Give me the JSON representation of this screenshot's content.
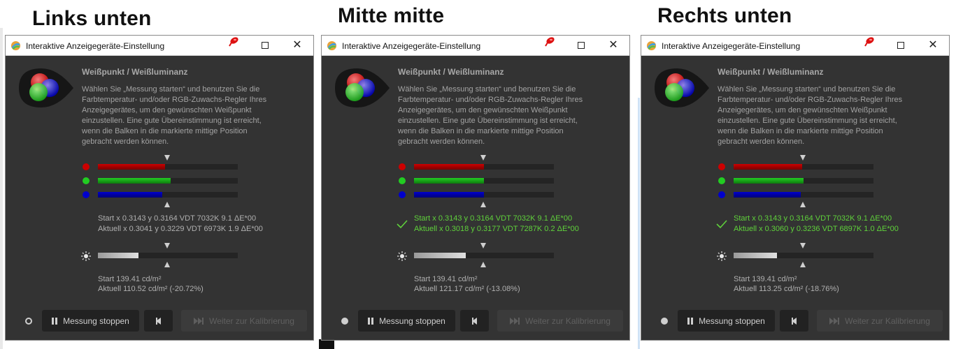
{
  "headings": [
    "Links unten",
    "Mitte mitte",
    "Rechts unten"
  ],
  "colors": {
    "red": "#cc0000",
    "green": "#22cc22",
    "blue": "#0000cc",
    "white_fill": "#e0e0e0",
    "ok_green": "#5fd13b",
    "window_bg": "#333333",
    "bar_track": "#242424"
  },
  "windows": [
    {
      "title": "Interaktive Anzeigegeräte-Einstellung",
      "section_title": "Weißpunkt / Weißluminanz",
      "description": "Wählen Sie „Messung starten“ und benutzen Sie die\nFarbtemperatur- und/oder RGB-Zuwachs-Regler Ihres\nAnzeigegerätes, um den gewünschten Weißpunkt\neinzustellen. Eine gute Übereinstimmung ist erreicht,\nwenn die Balken in die markierte mittige Position\ngebracht werden können.",
      "bars": {
        "red": 0.48,
        "green": 0.52,
        "blue": 0.46,
        "luminance": 0.29
      },
      "whitepoint_ok": false,
      "whitepoint_start": "Start x 0.3143 y 0.3164 VDT 7032K 9.1 ΔE*00",
      "whitepoint_current": "Aktuell x 0.3041 y 0.3229 VDT 6973K 1.9 ΔE*00",
      "luminance_start": "Start 139.41 cd/m²",
      "luminance_current": "Aktuell 110.52 cd/m² (-20.72%)",
      "status_indicator": "ring",
      "stop_button": "Messung stoppen",
      "next_button": "Weiter zur Kalibrierung"
    },
    {
      "title": "Interaktive Anzeigegeräte-Einstellung",
      "section_title": "Weißpunkt / Weißluminanz",
      "description": "Wählen Sie „Messung starten“ und benutzen Sie die\nFarbtemperatur- und/oder RGB-Zuwachs-Regler Ihres\nAnzeigegerätes, um den gewünschten Weißpunkt\neinzustellen. Eine gute Übereinstimmung ist erreicht,\nwenn die Balken in die markierte mittige Position\ngebracht werden können.",
      "bars": {
        "red": 0.5,
        "green": 0.5,
        "blue": 0.5,
        "luminance": 0.37
      },
      "whitepoint_ok": true,
      "whitepoint_start": "Start x 0.3143 y 0.3164 VDT 7032K 9.1 ΔE*00",
      "whitepoint_current": "Aktuell x 0.3018 y 0.3177 VDT 7287K 0.2 ΔE*00",
      "luminance_start": "Start 139.41 cd/m²",
      "luminance_current": "Aktuell 121.17 cd/m² (-13.08%)",
      "status_indicator": "dot",
      "stop_button": "Messung stoppen",
      "next_button": "Weiter zur Kalibrierung"
    },
    {
      "title": "Interaktive Anzeigegeräte-Einstellung",
      "section_title": "Weißpunkt / Weißluminanz",
      "description": "Wählen Sie „Messung starten“ und benutzen Sie die\nFarbtemperatur- und/oder RGB-Zuwachs-Regler Ihres\nAnzeigegerätes, um den gewünschten Weißpunkt\neinzustellen. Eine gute Übereinstimmung ist erreicht,\nwenn die Balken in die markierte mittige Position\ngebracht werden können.",
      "bars": {
        "red": 0.49,
        "green": 0.5,
        "blue": 0.48,
        "luminance": 0.31
      },
      "whitepoint_ok": true,
      "whitepoint_start": "Start x 0.3143 y 0.3164 VDT 7032K 9.1 ΔE*00",
      "whitepoint_current": "Aktuell x 0.3060 y 0.3236 VDT 6897K 1.0 ΔE*00",
      "luminance_start": "Start 139.41 cd/m²",
      "luminance_current": "Aktuell 113.25 cd/m² (-18.76%)",
      "status_indicator": "dot",
      "stop_button": "Messung stoppen",
      "next_button": "Weiter zur Kalibrierung"
    }
  ]
}
